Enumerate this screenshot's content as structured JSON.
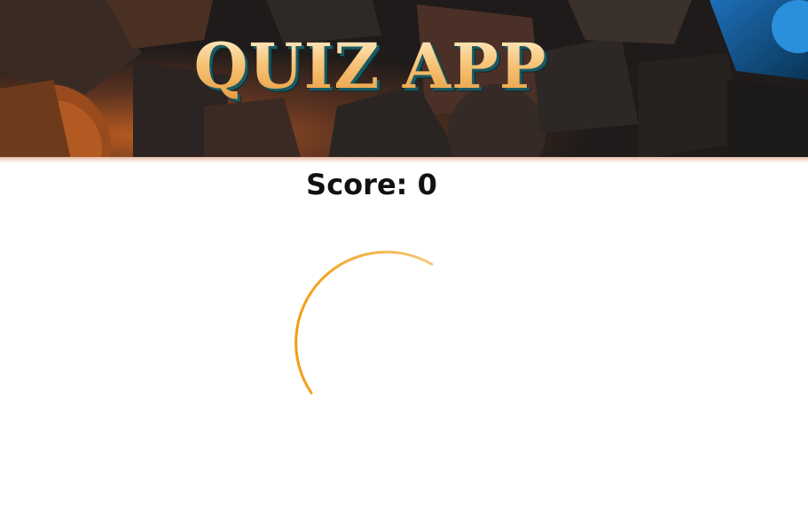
{
  "app": {
    "title": "QUIZ APP"
  },
  "score": {
    "label": "Score:",
    "value": "0"
  },
  "colors": {
    "accent": "#f39c12",
    "header_bg": "#1f1b1a",
    "title_gold": "#f2b25c",
    "title_shadow": "#1b5a63"
  },
  "loader": {
    "icon": "loading-spinner-icon"
  }
}
